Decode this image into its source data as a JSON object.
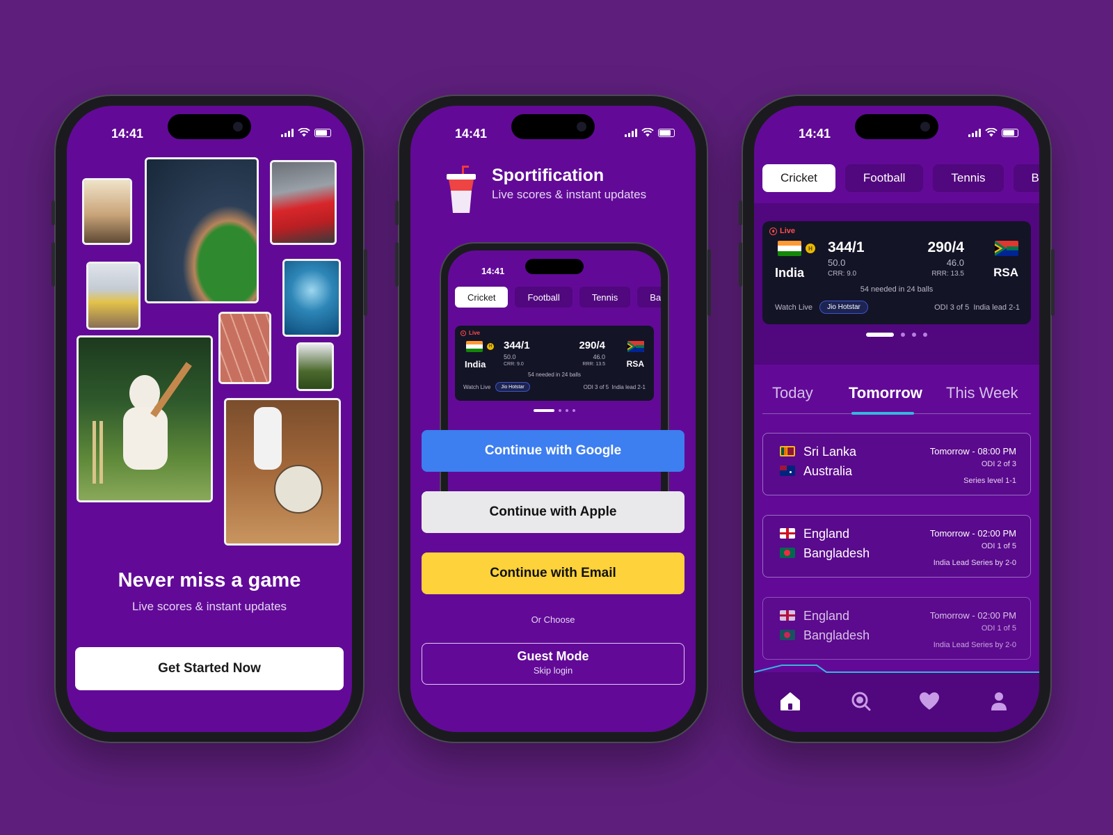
{
  "status": {
    "time": "14:41"
  },
  "onboarding": {
    "title": "Never miss a game",
    "subtitle": "Live scores & instant updates",
    "cta": "Get Started Now",
    "photos": [
      "basketball-photo",
      "stadium-photo",
      "racing-photo",
      "volleyball-photo",
      "swimming-photo",
      "track-photo",
      "football-photo",
      "cricket-photo",
      "soccer-photo"
    ]
  },
  "login": {
    "app_name": "Sportification",
    "tagline": "Live scores & instant updates",
    "google": "Continue with Google",
    "apple": "Continue with Apple",
    "email": "Continue with Email",
    "or_choose": "Or Choose",
    "guest_title": "Guest Mode",
    "guest_sub": "Skip login"
  },
  "sports_tabs": [
    "Cricket",
    "Football",
    "Tennis",
    "Ba"
  ],
  "live_match": {
    "live_label": "Live",
    "batting_badge": "H",
    "team1": {
      "name": "India",
      "score": "344/1",
      "overs": "50.0",
      "rate": "CRR: 9.0"
    },
    "team2": {
      "name": "RSA",
      "score": "290/4",
      "overs": "46.0",
      "rate": "RRR: 13.5"
    },
    "needed": "54 needed in 24 balls",
    "watch_label": "Watch Live",
    "broadcaster": "Jio Hotstar",
    "series": "ODI 3 of 5  India lead 2-1"
  },
  "periods": [
    "Today",
    "Tomorrow",
    "This Week"
  ],
  "upcoming": [
    {
      "team1": "Sri Lanka",
      "team2": "Australia",
      "when": "Tomorrow - 08:00 PM",
      "odi": "ODI 2 of 3",
      "series": "Series level 1-1"
    },
    {
      "team1": "England",
      "team2": "Bangladesh",
      "when": "Tomorrow - 02:00 PM",
      "odi": "ODI 1 of 5",
      "series": "India Lead Series by 2-0"
    },
    {
      "team1": "England",
      "team2": "Bangladesh",
      "when": "Tomorrow - 02:00 PM",
      "odi": "ODI 1 of 5",
      "series": "India Lead Series by 2-0"
    }
  ],
  "nav": [
    "home-icon",
    "search-icon",
    "heart-icon",
    "profile-icon"
  ],
  "colors": {
    "background": "#5e1f7c",
    "screen": "#620a97",
    "google": "#3d7ef0",
    "apple": "#e9e9ec",
    "email": "#fdd23a",
    "card": "#141427",
    "accent": "#34b7de",
    "live": "#ff4d4d"
  }
}
